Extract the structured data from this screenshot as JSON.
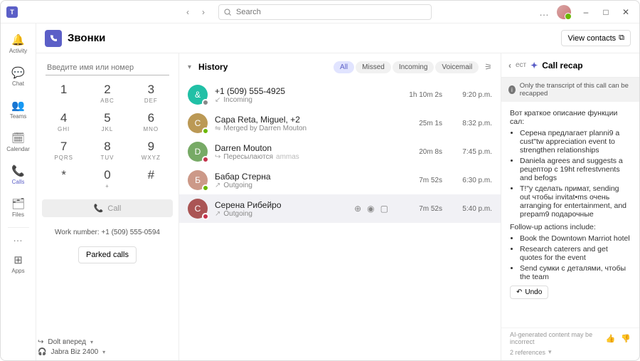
{
  "titlebar": {
    "search_placeholder": "Search"
  },
  "rail": {
    "items": [
      {
        "label": "Activity"
      },
      {
        "label": "Chat"
      },
      {
        "label": "Teams"
      },
      {
        "label": "Calendar"
      },
      {
        "label": "Calls"
      },
      {
        "label": "Files"
      }
    ],
    "apps_label": "Apps"
  },
  "header": {
    "title": "Звонки",
    "view_contacts": "View contacts"
  },
  "dialer": {
    "placeholder": "Введите имя или номер",
    "keys": [
      {
        "n": "1",
        "s": ""
      },
      {
        "n": "2",
        "s": "ABC"
      },
      {
        "n": "3",
        "s": "DEF"
      },
      {
        "n": "4",
        "s": "GHI"
      },
      {
        "n": "5",
        "s": "JKL"
      },
      {
        "n": "6",
        "s": "MNO"
      },
      {
        "n": "7",
        "s": "PQRS"
      },
      {
        "n": "8",
        "s": "TUV"
      },
      {
        "n": "9",
        "s": "WXYZ"
      },
      {
        "n": "*",
        "s": ""
      },
      {
        "n": "0",
        "s": "+"
      },
      {
        "n": "#",
        "s": ""
      }
    ],
    "call_label": "Call",
    "work_number": "Work number: +1 (509) 555-0594",
    "parked_label": "Parked calls"
  },
  "history": {
    "title": "History",
    "filters": [
      "All",
      "Missed",
      "Incoming",
      "Voicemail"
    ],
    "rows": [
      {
        "title": "+1 (509) 555-4925",
        "sub": "Incoming",
        "dur": "1h 10m 2s",
        "time": "9:20 p.m.",
        "avatar_bg": "#21c0a6",
        "presence": "off",
        "sub_icon": "incoming"
      },
      {
        "title": "Сара  Reta, Miguel, +2",
        "sub": "Merged by Darren Mouton",
        "dur": "25m 1s",
        "time": "8:32 p.m.",
        "avatar_bg": "#b95",
        "presence": "avail",
        "sub_icon": "merge"
      },
      {
        "title": "Darren Mouton",
        "sub": "Пересылаются",
        "dur": "20m 8s",
        "time": "7:45 p.m.",
        "avatar_bg": "#7a6",
        "presence": "busy",
        "sub_icon": "forward",
        "sub2": "ammas"
      },
      {
        "title": "Бабар Стерна",
        "sub": "Outgoing",
        "dur": "7m 52s",
        "time": "6:30 p.m.",
        "avatar_bg": "#c98",
        "presence": "avail",
        "sub_icon": "outgoing"
      },
      {
        "title": "Серена Рибейро",
        "sub": "Outgoing",
        "dur": "7m 52s",
        "time": "5:40 p.m.",
        "avatar_bg": "#a55",
        "presence": "busy",
        "sub_icon": "outgoing",
        "selected": true,
        "actions": true
      }
    ]
  },
  "recap": {
    "title_prefix": "ест",
    "title": "Call recap",
    "banner": "Only the transcript of this call can be recapped",
    "intro": "Вот краткое описание функции сал:",
    "bullets": [
      "Серена предлагает planni9 a cust\"tw appreciation event to strengthen relationships",
      "Daniela agrees and suggests a рецептор с 19ht refrestvnents       and befogs",
      "Т!\"у сделать примат,  sending out чтобы invitat•ms очень arranging for entertainment, and prepam9 подарочные"
    ],
    "followup_label": "Follow-up actions include:",
    "followups": [
      "Book the Downtown Marriot hotel",
      "Research caterers and get quotes for the event",
      "Send сумки с деталями, чтобы the team"
    ],
    "undo": "Undo",
    "disclaimer": "AI-generated content may be incorrect",
    "references": "2 references"
  },
  "footer": {
    "forward": "Dolt вперед",
    "device": "Jabra Biz 2400"
  }
}
